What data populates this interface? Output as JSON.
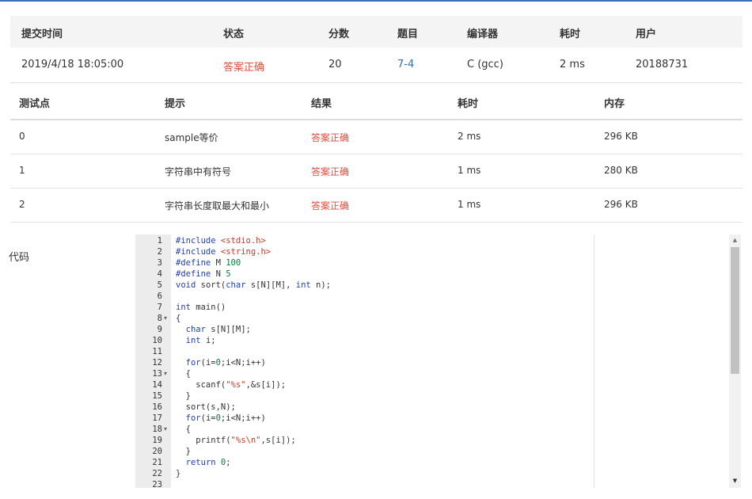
{
  "summary": {
    "headers": [
      "提交时间",
      "状态",
      "分数",
      "题目",
      "编译器",
      "耗时",
      "用户"
    ],
    "row": {
      "time": "2019/4/18 18:05:00",
      "status": "答案正确",
      "score": "20",
      "problem": "7-4",
      "compiler": "C (gcc)",
      "duration": "2 ms",
      "user": "20188731"
    }
  },
  "testcases": {
    "headers": [
      "测试点",
      "提示",
      "结果",
      "耗时",
      "内存"
    ],
    "rows": [
      {
        "id": "0",
        "hint": "sample等价",
        "result": "答案正确",
        "time": "2 ms",
        "memory": "296 KB"
      },
      {
        "id": "1",
        "hint": "字符串中有符号",
        "result": "答案正确",
        "time": "1 ms",
        "memory": "280 KB"
      },
      {
        "id": "2",
        "hint": "字符串长度取最大和最小",
        "result": "答案正确",
        "time": "1 ms",
        "memory": "296 KB"
      }
    ]
  },
  "code_section": {
    "label": "代码",
    "line_numbers": [
      "1",
      "2",
      "3",
      "4",
      "5",
      "6",
      "7",
      "8",
      "9",
      "10",
      "11",
      "12",
      "13",
      "14",
      "15",
      "16",
      "17",
      "18",
      "19",
      "20",
      "21",
      "22",
      "23"
    ],
    "fold_lines": [
      "8",
      "13",
      "18"
    ],
    "lines": [
      "#include <stdio.h>",
      "#include <string.h>",
      "#define M 100",
      "#define N 5",
      "void sort(char s[N][M], int n);",
      "",
      "int main()",
      "{",
      "  char s[N][M];",
      "  int i;",
      "",
      "  for(i=0;i<N;i++)",
      "  {",
      "    scanf(\"%s\",&s[i]);",
      "  }",
      "  sort(s,N);",
      "  for(i=0;i<N;i++)",
      "  {",
      "    printf(\"%s\\n\",s[i]);",
      "  }",
      "  return 0;",
      "}",
      ""
    ]
  },
  "colors": {
    "accent": "#3a6fb8",
    "success": "#e14c3c",
    "link": "#2f6eb5"
  }
}
